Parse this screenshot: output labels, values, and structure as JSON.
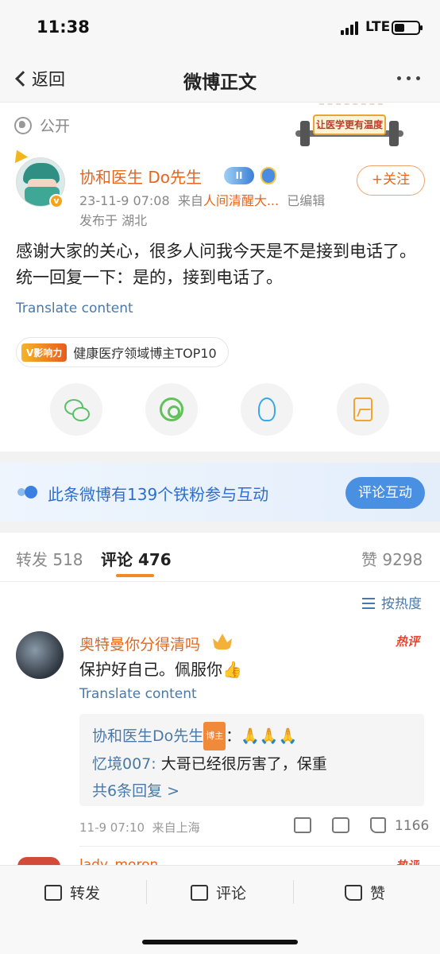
{
  "status_bar": {
    "time": "11:38",
    "network": "LTE"
  },
  "nav": {
    "back_label": "返回",
    "title": "微博正文"
  },
  "visibility": {
    "label": "公开",
    "banner_text": "让医学更有温度"
  },
  "post": {
    "author": "协和医生 Do先生",
    "level_badge": "II",
    "meta_time": "23-11-9 07:08",
    "meta_from_prefix": "来自",
    "meta_source": "人间清醒大...",
    "meta_edited": "已编辑",
    "location": "发布于 湖北",
    "follow_label": "+关注",
    "text": "感谢大家的关心，很多人问我今天是不是接到电话了。统一回复一下：是的，接到电话了。",
    "translate_label": "Translate content",
    "influence_tag": "V影响力",
    "influence_text": "健康医疗领域博主TOP10",
    "avatar_badge": "v"
  },
  "share_targets": [
    {
      "icon": "wechat-icon"
    },
    {
      "icon": "moments-icon"
    },
    {
      "icon": "qq-icon"
    },
    {
      "icon": "save-image-icon"
    }
  ],
  "fan_bar": {
    "text": "此条微博有139个铁粉参与互动",
    "button": "评论互动"
  },
  "tabs": {
    "repost": "转发 518",
    "comments": "评论 476",
    "likes": "赞 9298"
  },
  "sort": {
    "label": "按热度"
  },
  "comment": {
    "author": "奥特曼你分得清吗",
    "hot_tag": "热评",
    "text": "保护好自己。佩服你👍",
    "translate_label": "Translate content",
    "reply1_name": "协和医生Do先生",
    "reply1_badge": "博主",
    "reply1_text": "：🙏🙏🙏",
    "reply2_name": "忆境007:",
    "reply2_text": " 大哥已经很厉害了，保重",
    "more_replies": "共6条回复 >",
    "time": "11-9 07:10",
    "location": "来自上海",
    "likes": "1166"
  },
  "comment2": {
    "author": "lady_moron",
    "hot_tag": "热评"
  },
  "bottom_bar": {
    "repost": "转发",
    "comment": "评论",
    "like": "赞"
  },
  "colors": {
    "accent": "#e8651a",
    "link": "#4a79a8",
    "brand_blue": "#4a90e2"
  }
}
